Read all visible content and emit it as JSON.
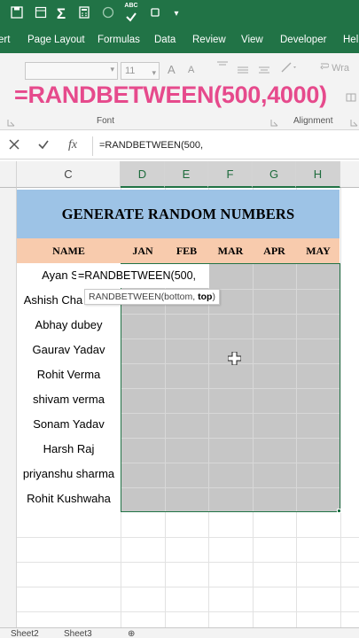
{
  "app": {
    "accent_color": "#217346"
  },
  "qat": {
    "icons": [
      "save-icon",
      "sum-icon",
      "calculator-icon",
      "circle-icon",
      "spelling-icon",
      "more-icon"
    ],
    "sum_glyph": "Σ",
    "abc_glyph": "ABC"
  },
  "ribbon_tabs": [
    "ert",
    "Page Layout",
    "Formulas",
    "Data",
    "Review",
    "View",
    "Developer",
    "Hel"
  ],
  "ribbon": {
    "font_size": "11",
    "grow_font": "A",
    "shrink_font": "A",
    "wrap_label": "Wra",
    "font_group_label": "Font",
    "alignment_group_label": "Alignment"
  },
  "overlay_formula": "=RANDBETWEEN(500,4000)",
  "formula_bar": {
    "fx_label": "fx",
    "content": "=RANDBETWEEN(500,"
  },
  "columns": [
    "C",
    "D",
    "E",
    "F",
    "G",
    "H"
  ],
  "sheet": {
    "title": "GENERATE RANDOM NUMBERS",
    "headers": [
      "NAME",
      "JAN",
      "FEB",
      "MAR",
      "APR",
      "MAY"
    ],
    "names": [
      "Ayan S",
      "Ashish Cha",
      "Abhay dubey",
      "Gaurav Yadav",
      "Rohit Verma",
      "shivam verma",
      "Sonam Yadav",
      "Harsh Raj",
      "priyanshu sharma",
      "Rohit Kushwaha"
    ],
    "title_band_color": "#9dc3e6",
    "header_band_color": "#f8cbad",
    "selection_fill_color": "#c6c6c6"
  },
  "cell_edit": {
    "text": "=RANDBETWEEN(500,"
  },
  "tooltip": {
    "function": "RANDBETWEEN(bottom, ",
    "bold_arg": "top",
    "close": ")"
  },
  "sheet_tabs": [
    "Sheet2",
    "Sheet3"
  ]
}
